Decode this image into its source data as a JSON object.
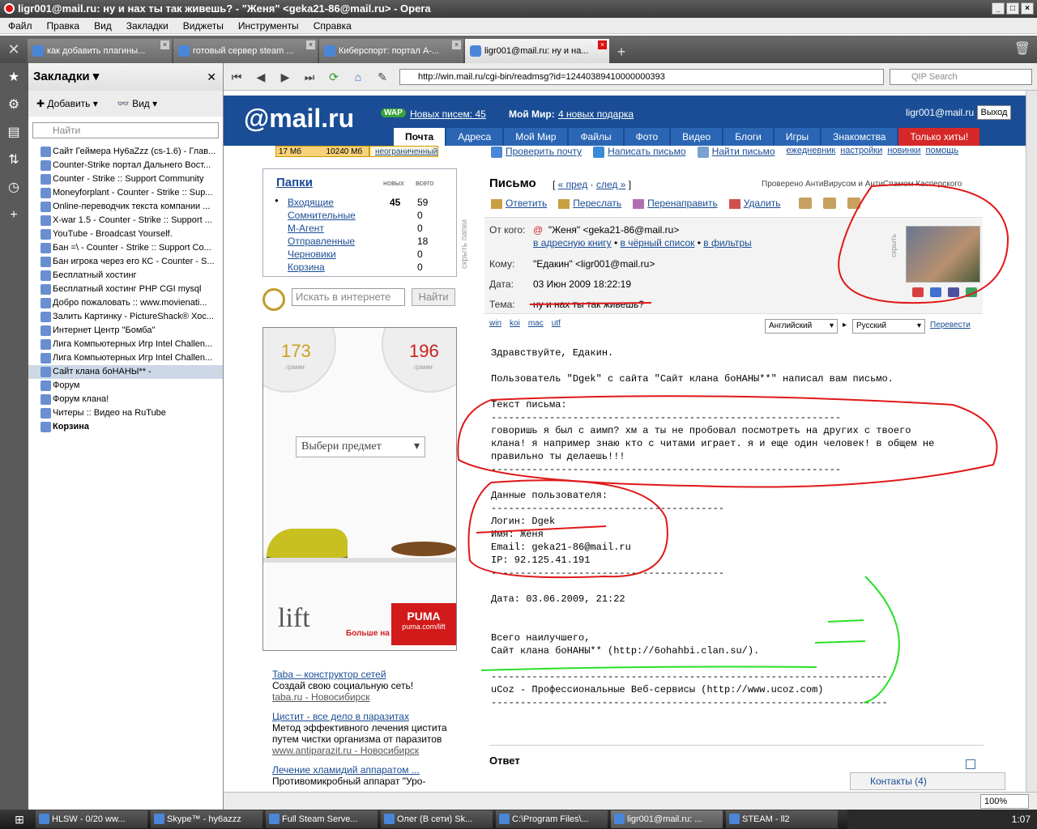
{
  "window": {
    "title": "ligr001@mail.ru: ну и нах ты так живешь? - \"Женя\" <geka21-86@mail.ru> - Opera"
  },
  "menu": [
    "Файл",
    "Правка",
    "Вид",
    "Закладки",
    "Виджеты",
    "Инструменты",
    "Справка"
  ],
  "tabs": [
    {
      "label": "как добавить плагины...",
      "active": false
    },
    {
      "label": "готовый сервер steam ...",
      "active": false
    },
    {
      "label": "Киберспорт: портал А-...",
      "active": false
    },
    {
      "label": "ligr001@mail.ru: ну и на...",
      "active": true
    }
  ],
  "panel": {
    "title": "Закладки",
    "add_label": "Добавить",
    "view_label": "Вид",
    "search_placeholder": "Найти",
    "bookmarks": [
      "Сайт Геймера Hy6aZzz (cs-1.6) - Глав...",
      "Counter-Strike портал Дальнего Вост...",
      "Counter - Strike :: Support Community",
      "Moneyforplant - Counter - Strike :: Sup...",
      "Online-переводчик текста компании ...",
      "X-war 1.5 - Counter - Strike :: Support ...",
      "YouTube - Broadcast Yourself.",
      "Бан =\\ - Counter - Strike :: Support Co...",
      "Бан игрока через его КС - Counter - S...",
      "Бесплатный хостинг",
      "Бесплатный хостинг PHP CGI mysql",
      "Добро пожаловать :: www.movienati...",
      "Залить Картинку - PictureShack® Хос...",
      "Интернет Центр \"Бомба\"",
      "Лига Компьютерных Игр Intel Challen...",
      "Лига Компьютерных Игр Intel Challen...",
      "Сайт клана боНАНЫ** -",
      "Форум",
      "Форум клана!",
      "Читеры :: Видео на RuTube"
    ],
    "trash_label": "Корзина"
  },
  "nav": {
    "url": "http://win.mail.ru/cgi-bin/readmsg?id=12440389410000000393",
    "search_placeholder": "QIP Search"
  },
  "mailru": {
    "logo": "@mail.ru",
    "wap": "WAP",
    "new_letters": "Новых писем: 45",
    "my_world": "Мой Мир:",
    "gifts": "4 новых подарка",
    "user": "ligr001@mail.ru",
    "exit": "Выход",
    "tabs": [
      "Почта",
      "Адреса",
      "Мой Мир",
      "Файлы",
      "Фото",
      "Видео",
      "Блоги",
      "Игры",
      "Знакомства",
      "Только хиты!"
    ],
    "quota_used": "17 Мб",
    "quota_total": "10240 Мб",
    "quota_unlimited": "неограниченный"
  },
  "folders": {
    "title": "Папки",
    "col_new": "новых",
    "col_total": "всего",
    "hide_label": "скрыть папки",
    "items": [
      {
        "name": "Входящие",
        "new": "45",
        "total": "59"
      },
      {
        "name": "Сомнительные",
        "new": "",
        "total": "0"
      },
      {
        "name": "М-Агент",
        "new": "",
        "total": "0"
      },
      {
        "name": "Отправленные",
        "new": "",
        "total": "18"
      },
      {
        "name": "Черновики",
        "new": "",
        "total": "0"
      },
      {
        "name": "Корзина",
        "new": "",
        "total": "0"
      }
    ]
  },
  "websearch": {
    "placeholder": "Искать в интернете",
    "button": "Найти"
  },
  "ad": {
    "left_num": "173",
    "left_sub": "грамм",
    "right_num": "196",
    "right_sub": "грамм",
    "select": "Выбери предмет",
    "brand": "lift",
    "more": "Больше на",
    "puma": "PUMA",
    "puma_url": "puma.com/lift"
  },
  "textads": [
    {
      "title": "Taba – конструктор сетей",
      "desc": "Создай свою социальную сеть!",
      "site": "taba.ru - Новосибирск"
    },
    {
      "title": "Цистит - все дело в паразитах",
      "desc": "Метод эффективного лечения цистита путем чистки организма от паразитов",
      "site": "www.antiparazit.ru - Новосибирск"
    },
    {
      "title": "Лечение хламидий аппаратом ...",
      "desc": "Противомикробный аппарат \"Уро-",
      "site": ""
    }
  ],
  "toolbar": {
    "check": "Проверить почту",
    "write": "Написать письмо",
    "find": "Найти письмо",
    "diary": "ежедневник",
    "settings": "настройки",
    "news": "новинки",
    "help": "помощь"
  },
  "letter": {
    "header": "Письмо",
    "prev": "« пред",
    "next": "след »",
    "checked": "Проверено АнтиВирусом и АнтиСпамом Касперского",
    "actions": [
      "Ответить",
      "Переслать",
      "Перенаправить",
      "Удалить"
    ],
    "from_label": "От кого:",
    "from": "\"Женя\" <geka21-86@mail.ru>",
    "from_links": [
      "в адресную книгу",
      "в чёрный список",
      "в фильтры"
    ],
    "to_label": "Кому:",
    "to": "\"Едакин\" <ligr001@mail.ru>",
    "date_label": "Дата:",
    "date": "03 Июн 2009 18:22:19",
    "subject_label": "Тема:",
    "subject": "ну и нах ты так живешь?",
    "hide_label": "скрыть",
    "encodings": [
      "win",
      "koi",
      "mac",
      "utf"
    ],
    "lang_from": "Английский",
    "lang_to": "Русский",
    "translate": "Перевести",
    "body_lines": [
      "Здравствуйте, Едакин.",
      "",
      "Пользователь \"Dgek\" с сайта \"Сайт клана боНАНЫ**\" написал вам письмо.",
      "",
      "Текст письма:",
      "------------------------------------------------------------",
      "говоришь я был с аимп? хм а ты не пробовал посмотреть на других с твоего",
      "клана! я например знаю кто с читами играет. я и еще один человек! в общем не",
      "правильно ты делаешь!!!",
      "------------------------------------------------------------",
      "",
      "Данные пользователя:",
      "----------------------------------------",
      "Логин: Dgek",
      "Имя: Женя",
      "Email: geka21-86@mail.ru",
      "IP: 92.125.41.191",
      "----------------------------------------",
      "",
      "Дата: 03.06.2009, 21:22",
      "",
      "",
      "Всего наилучшего,",
      "Сайт клана боНАНЫ** (http://6ohahbi.clan.su/).",
      "",
      "--------------------------------------------------------------------",
      "uCoz - Профессиональные Веб-сервисы (http://www.ucoz.com)",
      "--------------------------------------------------------------------"
    ],
    "answer_label": "Ответ",
    "contacts": "Контакты (4)"
  },
  "statusbar": {
    "zoom": "100%"
  },
  "taskbar": {
    "items": [
      "HLSW - 0/20 ww...",
      "Skype™ - hy6azzz",
      "Full Steam Serve...",
      "Олег (В сети) Sk...",
      "C:\\Program Files\\...",
      "ligr001@mail.ru: ...",
      "STEAM - ll2"
    ],
    "active_index": 5,
    "clock": "1:07"
  }
}
